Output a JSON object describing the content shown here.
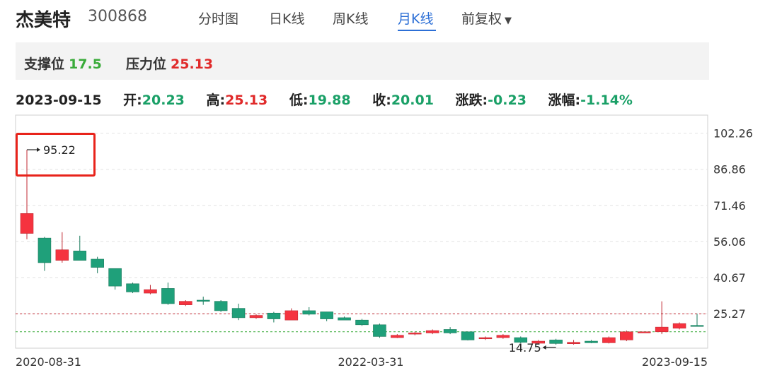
{
  "header": {
    "stock_name": "杰美特",
    "stock_code": "300868",
    "tabs": [
      {
        "label": "分时图",
        "active": false
      },
      {
        "label": "日K线",
        "active": false
      },
      {
        "label": "周K线",
        "active": false
      },
      {
        "label": "月K线",
        "active": true
      },
      {
        "label": "前复权",
        "active": false
      }
    ]
  },
  "support_pressure": {
    "support_label": "支撑位",
    "support_value": "17.5",
    "pressure_label": "压力位",
    "pressure_value": "25.13"
  },
  "quote": {
    "date": "2023-09-15",
    "open_label": "开:",
    "open": "20.23",
    "high_label": "高:",
    "high": "25.13",
    "low_label": "低:",
    "low": "19.88",
    "close_label": "收:",
    "close": "20.01",
    "change_label": "涨跌:",
    "change": "-0.23",
    "pct_label": "涨幅:",
    "pct": "-1.14%"
  },
  "chart_data": {
    "type": "candlestick",
    "period": "monthly",
    "y_ticks": [
      "102.26",
      "86.86",
      "71.46",
      "56.06",
      "40.67",
      "25.27"
    ],
    "y_tick_values": [
      102.26,
      86.86,
      71.46,
      56.06,
      40.67,
      25.27
    ],
    "x_labels": [
      "2020-08-31",
      "2022-03-31",
      "2023-09-15"
    ],
    "ylim": [
      10.5,
      110
    ],
    "max_annotation": "95.22",
    "min_annotation": "14.75",
    "support_line": 17.5,
    "pressure_line": 25.13,
    "colors": {
      "up": "#f5333f",
      "down": "#1fa07a",
      "support": "#3aab3a",
      "pressure": "#c9303a"
    },
    "candles": [
      {
        "o": 59.5,
        "h": 95.22,
        "l": 57.0,
        "c": 68.0
      },
      {
        "o": 57.5,
        "h": 58.0,
        "l": 43.5,
        "c": 47.0
      },
      {
        "o": 48.0,
        "h": 60.0,
        "l": 47.0,
        "c": 52.5
      },
      {
        "o": 52.0,
        "h": 58.5,
        "l": 48.5,
        "c": 48.0
      },
      {
        "o": 48.5,
        "h": 49.5,
        "l": 42.5,
        "c": 45.0
      },
      {
        "o": 44.5,
        "h": 44.5,
        "l": 35.5,
        "c": 37.0
      },
      {
        "o": 38.0,
        "h": 38.5,
        "l": 34.0,
        "c": 34.5
      },
      {
        "o": 34.0,
        "h": 37.5,
        "l": 33.5,
        "c": 35.5
      },
      {
        "o": 36.0,
        "h": 38.5,
        "l": 29.0,
        "c": 29.5
      },
      {
        "o": 29.0,
        "h": 31.0,
        "l": 28.5,
        "c": 30.5
      },
      {
        "o": 31.0,
        "h": 32.5,
        "l": 29.0,
        "c": 30.5
      },
      {
        "o": 30.5,
        "h": 31.0,
        "l": 26.0,
        "c": 26.5
      },
      {
        "o": 27.5,
        "h": 29.5,
        "l": 22.5,
        "c": 23.5
      },
      {
        "o": 23.5,
        "h": 25.0,
        "l": 23.0,
        "c": 24.5
      },
      {
        "o": 25.5,
        "h": 26.0,
        "l": 21.5,
        "c": 23.0
      },
      {
        "o": 22.5,
        "h": 27.5,
        "l": 22.5,
        "c": 26.5
      },
      {
        "o": 26.5,
        "h": 28.0,
        "l": 24.5,
        "c": 25.0
      },
      {
        "o": 26.0,
        "h": 26.0,
        "l": 22.0,
        "c": 23.0
      },
      {
        "o": 23.5,
        "h": 24.0,
        "l": 22.5,
        "c": 22.5
      },
      {
        "o": 22.5,
        "h": 23.0,
        "l": 20.0,
        "c": 20.5
      },
      {
        "o": 20.5,
        "h": 21.0,
        "l": 14.9,
        "c": 15.5
      },
      {
        "o": 15.0,
        "h": 16.5,
        "l": 14.8,
        "c": 16.0
      },
      {
        "o": 16.5,
        "h": 17.5,
        "l": 16.0,
        "c": 17.0
      },
      {
        "o": 17.0,
        "h": 18.5,
        "l": 16.5,
        "c": 18.0
      },
      {
        "o": 18.5,
        "h": 19.5,
        "l": 16.5,
        "c": 17.0
      },
      {
        "o": 17.5,
        "h": 17.5,
        "l": 13.8,
        "c": 14.0
      },
      {
        "o": 14.5,
        "h": 15.5,
        "l": 14.0,
        "c": 15.0
      },
      {
        "o": 15.0,
        "h": 16.5,
        "l": 14.5,
        "c": 16.0
      },
      {
        "o": 15.0,
        "h": 15.5,
        "l": 12.6,
        "c": 13.0
      },
      {
        "o": 12.6,
        "h": 14.0,
        "l": 12.5,
        "c": 13.5
      },
      {
        "o": 14.0,
        "h": 14.5,
        "l": 12.0,
        "c": 12.5
      },
      {
        "o": 12.4,
        "h": 14.0,
        "l": 12.0,
        "c": 13.0
      },
      {
        "o": 13.5,
        "h": 14.0,
        "l": 12.6,
        "c": 12.8
      },
      {
        "o": 12.8,
        "h": 15.5,
        "l": 12.5,
        "c": 15.0
      },
      {
        "o": 14.0,
        "h": 18.0,
        "l": 13.5,
        "c": 17.5
      },
      {
        "o": 17.0,
        "h": 17.5,
        "l": 17.0,
        "c": 17.5
      },
      {
        "o": 17.5,
        "h": 30.5,
        "l": 16.5,
        "c": 19.5
      },
      {
        "o": 19.0,
        "h": 21.5,
        "l": 18.5,
        "c": 21.0
      },
      {
        "o": 20.23,
        "h": 25.13,
        "l": 19.88,
        "c": 20.01
      }
    ]
  }
}
